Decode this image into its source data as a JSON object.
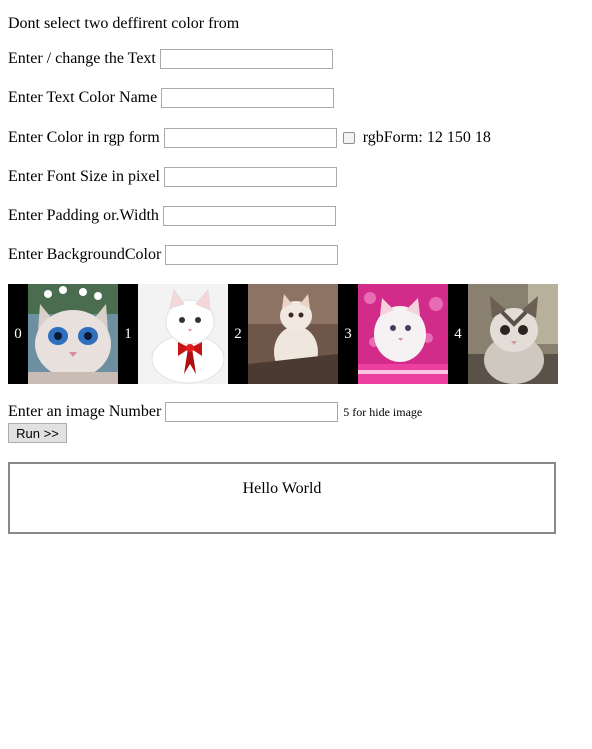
{
  "intro": "Dont select two deffirent color from",
  "fields": {
    "text_label": "Enter / change the Text",
    "text_value": "",
    "color_name_label": "Enter Text Color Name",
    "color_name_value": "",
    "rgb_label": "Enter Color in rgp form",
    "rgb_value": "",
    "rgb_checkbox_label": "rgbForm: 12 150 18",
    "font_size_label": "Enter Font Size in pixel",
    "font_size_value": "",
    "padding_label": "Enter Padding or.Width",
    "padding_value": "",
    "bg_label": "Enter BackgroundColor",
    "bg_value": ""
  },
  "gallery": [
    {
      "index": "0",
      "icon": "kitten-blue-eyes-image"
    },
    {
      "index": "1",
      "icon": "kitten-red-bow-image"
    },
    {
      "index": "2",
      "icon": "kitten-sitting-image"
    },
    {
      "index": "3",
      "icon": "kitten-pink-background-image"
    },
    {
      "index": "4",
      "icon": "tabby-cat-image"
    }
  ],
  "image_number": {
    "label": "Enter an image Number",
    "value": "",
    "hint": "5 for hide image"
  },
  "run_button": "Run >>",
  "preview_text": "Hello World"
}
